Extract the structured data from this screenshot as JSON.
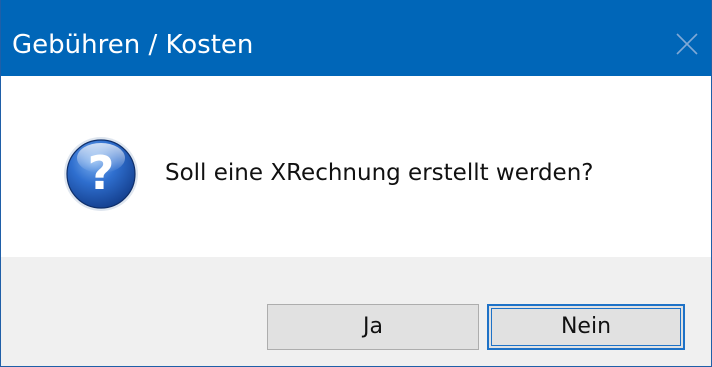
{
  "window": {
    "title": "Gebühren / Kosten",
    "close_icon": "close-icon"
  },
  "dialog": {
    "icon": "question-icon",
    "message": "Soll eine XRechnung erstellt werden?"
  },
  "buttons": {
    "yes_label": "Ja",
    "no_label": "Nein"
  },
  "colors": {
    "titlebar": "#0066b8",
    "button_bar": "#f0f0f0",
    "default_button_border": "#1e72c7"
  }
}
